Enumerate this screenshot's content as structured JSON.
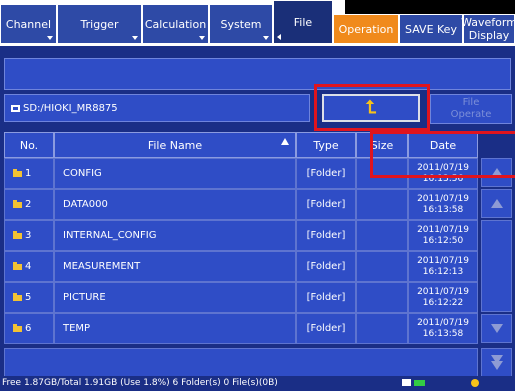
{
  "tabs": [
    {
      "label": "Channel"
    },
    {
      "label": "Trigger"
    },
    {
      "label": "Calculation"
    },
    {
      "label": "System"
    },
    {
      "label": "File"
    },
    {
      "label": "Operation"
    },
    {
      "label": "SAVE Key"
    },
    {
      "label_line1": "Waveform",
      "label_line2": "Display"
    }
  ],
  "path": "SD:/HIOKI_MR8875",
  "buttons": {
    "file_operate_line1": "File",
    "file_operate_line2": "Operate"
  },
  "table": {
    "headers": {
      "no": "No.",
      "name": "File Name",
      "type": "Type",
      "size": "Size",
      "date": "Date"
    },
    "rows": [
      {
        "no": "1",
        "name": "CONFIG",
        "type": "[Folder]",
        "size": "",
        "date": "2011/07/19",
        "time": "16:13:56"
      },
      {
        "no": "2",
        "name": "DATA000",
        "type": "[Folder]",
        "size": "",
        "date": "2011/07/19",
        "time": "16:13:58"
      },
      {
        "no": "3",
        "name": "INTERNAL_CONFIG",
        "type": "[Folder]",
        "size": "",
        "date": "2011/07/19",
        "time": "16:12:50"
      },
      {
        "no": "4",
        "name": "MEASUREMENT",
        "type": "[Folder]",
        "size": "",
        "date": "2011/07/19",
        "time": "16:12:13"
      },
      {
        "no": "5",
        "name": "PICTURE",
        "type": "[Folder]",
        "size": "",
        "date": "2011/07/19",
        "time": "16:12:22"
      },
      {
        "no": "6",
        "name": "TEMP",
        "type": "[Folder]",
        "size": "",
        "date": "2011/07/19",
        "time": "16:13:58"
      }
    ]
  },
  "status": {
    "summary": "Free 1.87GB/Total 1.91GB (Use 1.8%)  6 Folder(s) 0 File(s)(0B)"
  },
  "colors": {
    "tab_blue": "#2e4aa6",
    "tab_active": "#1a2f78",
    "operation_orange": "#f08a1c",
    "panel": "#1a2e86",
    "cell": "#2f4dc6",
    "highlight_red": "#e0141e",
    "folder_yellow": "#f2c233"
  }
}
